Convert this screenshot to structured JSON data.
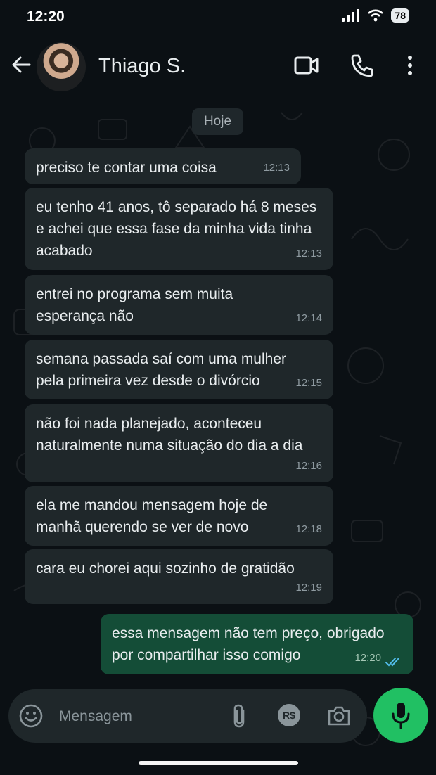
{
  "status_bar": {
    "time": "12:20",
    "battery": "78"
  },
  "header": {
    "contact_name": "Thiago S."
  },
  "date_chip": "Hoje",
  "messages": [
    {
      "text": "preciso te contar uma coisa",
      "time": "12:13",
      "direction": "in"
    },
    {
      "text": "eu tenho 41 anos, tô separado há 8 meses e achei que essa fase da minha vida tinha acabado",
      "time": "12:13",
      "direction": "in"
    },
    {
      "text": "entrei no programa sem muita esperança não",
      "time": "12:14",
      "direction": "in"
    },
    {
      "text": "semana passada saí com uma mulher pela primeira vez desde o divórcio",
      "time": "12:15",
      "direction": "in"
    },
    {
      "text": "não foi nada planejado, aconteceu naturalmente numa situação do dia a dia",
      "time": "12:16",
      "direction": "in"
    },
    {
      "text": "ela me mandou mensagem hoje de manhã querendo se ver de novo",
      "time": "12:18",
      "direction": "in"
    },
    {
      "text": "cara eu chorei aqui sozinho de gratidão",
      "time": "12:19",
      "direction": "in"
    },
    {
      "text": "essa mensagem não tem preço, obrigado por compartilhar isso comigo",
      "time": "12:20",
      "direction": "out",
      "status": "read"
    }
  ],
  "composer": {
    "placeholder": "Mensagem",
    "payment_label": "R$"
  },
  "icons": {
    "back": "arrow-left-icon",
    "video": "video-call-icon",
    "phone": "phone-call-icon",
    "menu": "more-vertical-icon",
    "emoji": "emoji-icon",
    "attach": "paperclip-icon",
    "payment": "payment-icon",
    "camera": "camera-icon",
    "mic": "microphone-icon"
  },
  "colors": {
    "background": "#0b1014",
    "incoming_bubble": "#1f272a",
    "outgoing_bubble": "#144d37",
    "accent": "#21c063",
    "read_ticks": "#53bdeb"
  }
}
